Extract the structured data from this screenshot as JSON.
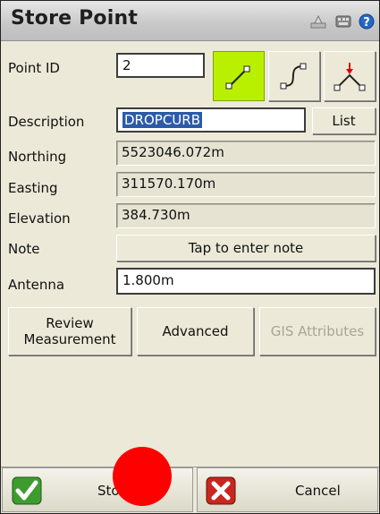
{
  "window": {
    "title": "Store Point"
  },
  "title_icons": [
    "bell-icon",
    "keyboard-icon",
    "help-icon"
  ],
  "fields": {
    "point_id": {
      "label": "Point ID",
      "value": "2"
    },
    "description": {
      "label": "Description",
      "value": "DROPCURB"
    },
    "northing": {
      "label": "Northing",
      "value": "5523046.072m"
    },
    "easting": {
      "label": "Easting",
      "value": "311570.170m"
    },
    "elevation": {
      "label": "Elevation",
      "value": "384.730m"
    },
    "note": {
      "label": "Note",
      "button": "Tap to enter note"
    },
    "antenna": {
      "label": "Antenna",
      "value": "1.800m"
    }
  },
  "list_button": "List",
  "mode_buttons": [
    "line-mode-icon",
    "curve-mode-icon",
    "arc-mode-icon"
  ],
  "actions": {
    "review_line1": "Review",
    "review_line2": "Measurement",
    "advanced": "Advanced",
    "gis": "GIS Attributes"
  },
  "bottom": {
    "store": "Store",
    "cancel": "Cancel"
  },
  "colors": {
    "active_mode": "#b8f000",
    "selection": "#2d5aa8",
    "overlay_dot": "#ff0000"
  }
}
